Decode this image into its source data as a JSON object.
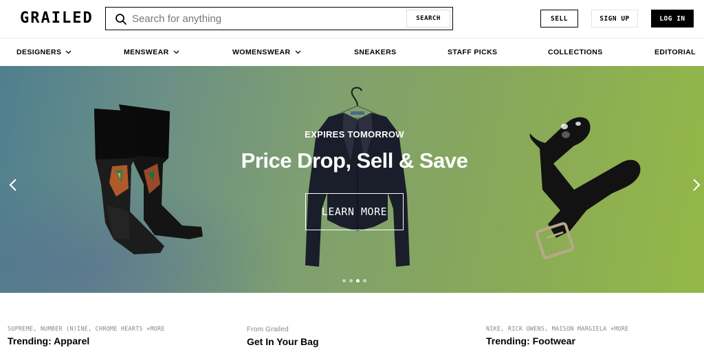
{
  "header": {
    "logo": "GRAILED",
    "search": {
      "placeholder": "Search for anything",
      "button": "SEARCH"
    },
    "sell": "SELL",
    "signup": "SIGN UP",
    "login": "LOG IN"
  },
  "nav": {
    "items": [
      {
        "label": "DESIGNERS",
        "dropdown": true
      },
      {
        "label": "MENSWEAR",
        "dropdown": true
      },
      {
        "label": "WOMENSWEAR",
        "dropdown": true
      },
      {
        "label": "SNEAKERS"
      },
      {
        "label": "STAFF PICKS"
      },
      {
        "label": "COLLECTIONS"
      },
      {
        "label": "EDITORIAL"
      }
    ]
  },
  "hero": {
    "subtitle": "EXPIRES TOMORROW",
    "title": "Price Drop, Sell & Save",
    "cta": "LEARN MORE",
    "slide_count": 4,
    "active_slide": 3
  },
  "sections": [
    {
      "tag": "SUPREME, NUMBER (N)INE, CHROME HEARTS +MORE",
      "title": "Trending: Apparel"
    },
    {
      "tag": "From Grailed",
      "title": "Get In Your Bag"
    },
    {
      "tag": "NIKE, RICK OWENS, MAISON MARGIELA +MORE",
      "title": "Trending: Footwear"
    }
  ],
  "colors": {
    "primary": "#000000",
    "background": "#ffffff",
    "hero_left": "#4f7f8f",
    "hero_right": "#94b847"
  }
}
